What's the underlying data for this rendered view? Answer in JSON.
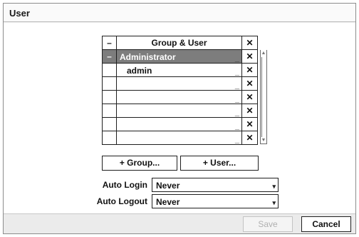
{
  "dialog": {
    "title": "User"
  },
  "table": {
    "header": {
      "minus": "–",
      "name": "Group & User",
      "delete": "✕"
    },
    "rows": [
      {
        "minus": "–",
        "name": "Administrator",
        "underscore": "_",
        "delete": "✕",
        "selected": true,
        "indent": false
      },
      {
        "minus": "",
        "name": "admin",
        "underscore": "_",
        "delete": "✕",
        "selected": false,
        "indent": true
      },
      {
        "minus": "",
        "name": "",
        "underscore": "_",
        "delete": "✕"
      },
      {
        "minus": "",
        "name": "",
        "underscore": "_",
        "delete": "✕"
      },
      {
        "minus": "",
        "name": "",
        "underscore": "_",
        "delete": "✕"
      },
      {
        "minus": "",
        "name": "",
        "underscore": "_",
        "delete": "✕"
      },
      {
        "minus": "",
        "name": "",
        "underscore": "_",
        "delete": "✕"
      }
    ]
  },
  "buttons": {
    "add_group": "+ Group...",
    "add_user": "+ User..."
  },
  "settings": {
    "auto_login": {
      "label": "Auto Login",
      "value": "Never"
    },
    "auto_logout": {
      "label": "Auto Logout",
      "value": "Never"
    }
  },
  "footer": {
    "save": "Save",
    "cancel": "Cancel"
  },
  "icons": {
    "dropdown": "▾",
    "scroll_up": "▲",
    "scroll_down": "▼"
  }
}
